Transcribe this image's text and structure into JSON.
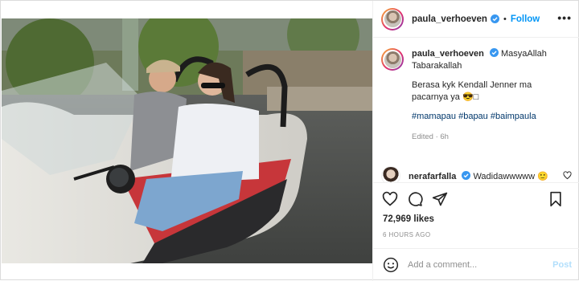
{
  "post": {
    "username": "paula_verhoeven",
    "follow_label": "Follow",
    "more_label": "•••",
    "separator": "•"
  },
  "caption": {
    "username": "paula_verhoeven",
    "line1": "MasyaAllah Tabarakallah",
    "line2": "Berasa kyk Kendall Jenner ma pacarnya ya 😎□",
    "tags": "#mamapau #bapau #baimpaula",
    "edited": "Edited · 6h"
  },
  "comment": {
    "username": "nerafarfalla",
    "text": "Wadidawwwww 🙂"
  },
  "stats": {
    "likes": "72,969 likes",
    "time_ago": "6 HOURS AGO"
  },
  "add_comment": {
    "placeholder": "Add a comment...",
    "post_label": "Post"
  },
  "icons": {
    "like": "heart-icon",
    "comment": "comment-icon",
    "share": "paper-plane-icon",
    "save": "bookmark-icon",
    "emoji": "smiley-icon",
    "verified": "verified-badge-icon"
  },
  "colors": {
    "accent": "#0095f6",
    "hashtag": "#00376b",
    "muted": "#8e8e8e",
    "post_disabled": "#b2dffc"
  }
}
